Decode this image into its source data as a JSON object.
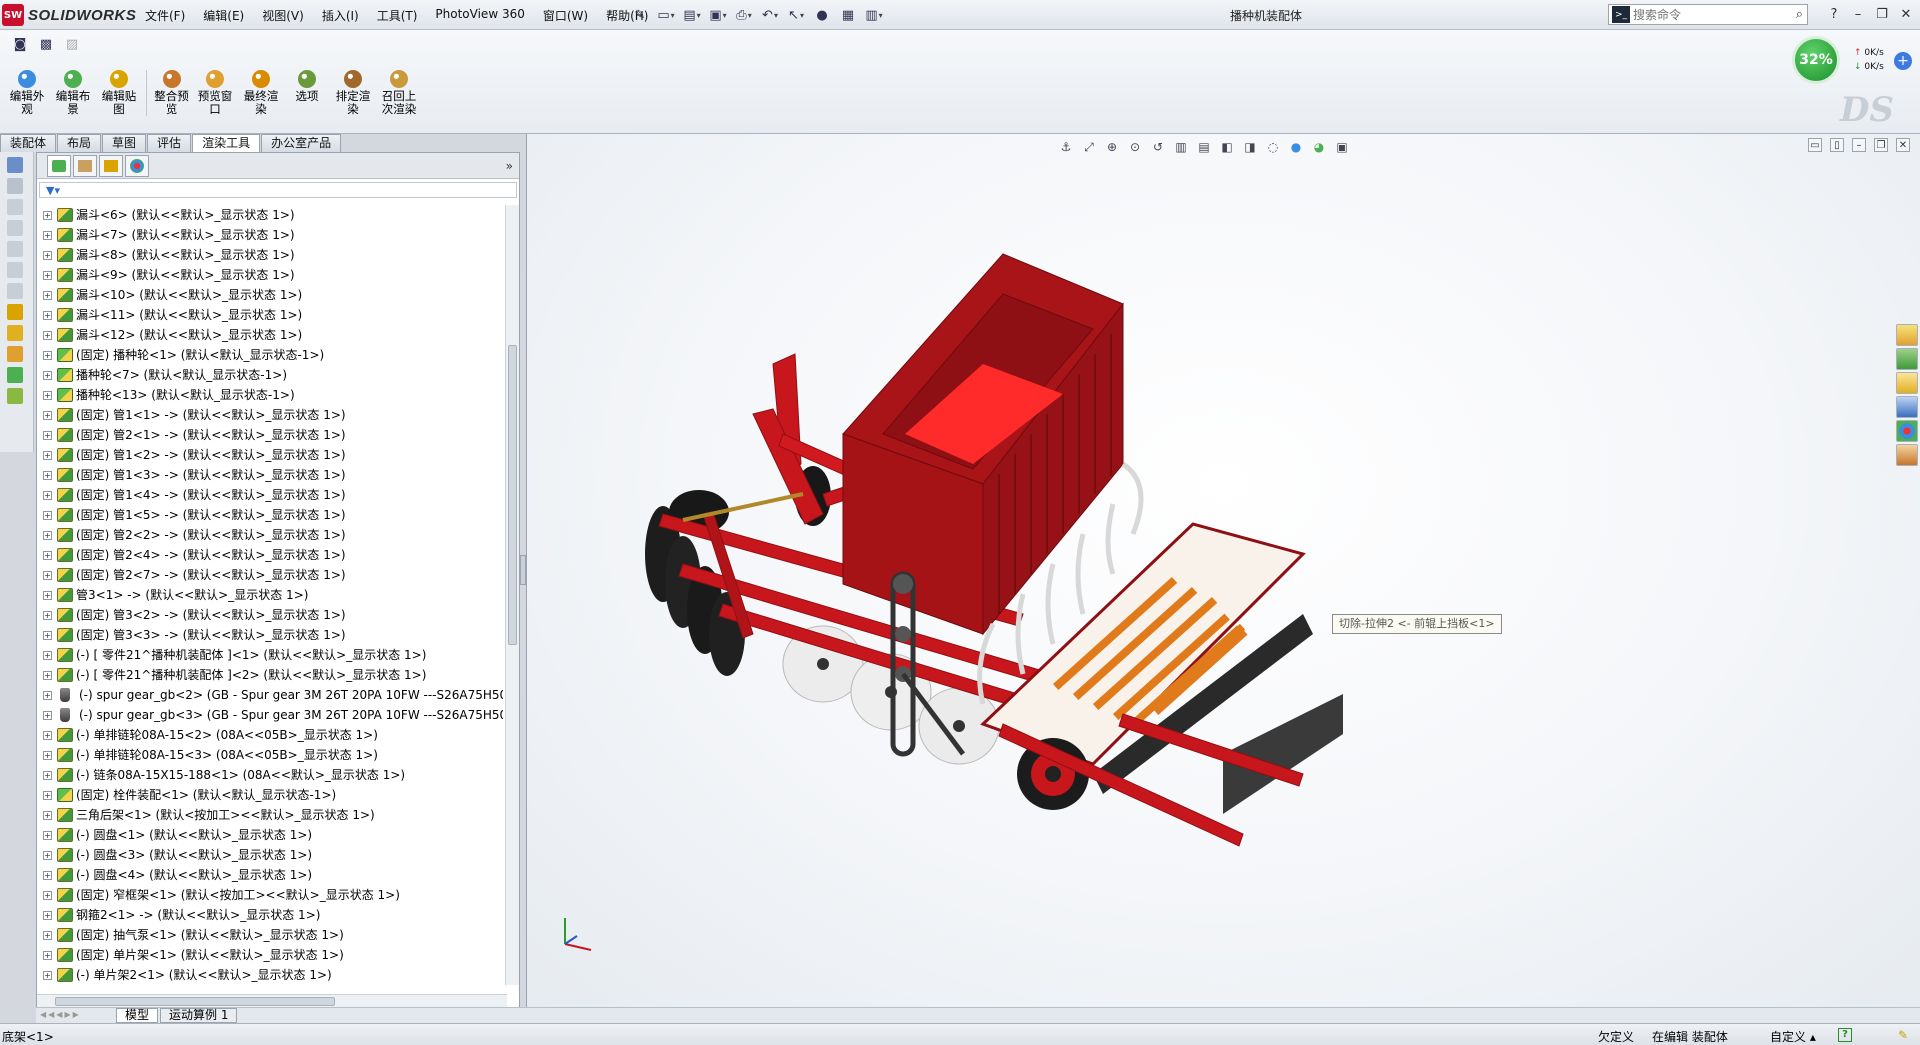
{
  "app": {
    "logo_badge": "SW",
    "logo_text": "SOLIDWORKS",
    "doc_title": "播种机装配体"
  },
  "menu": [
    "文件(F)",
    "编辑(E)",
    "视图(V)",
    "插入(I)",
    "工具(T)",
    "PhotoView 360",
    "窗口(W)",
    "帮助(H)"
  ],
  "search": {
    "placeholder": "搜索命令",
    "cmd_glyph": ">_"
  },
  "ribbon_buttons": [
    {
      "label": "编辑外观",
      "color": "#3a8de0"
    },
    {
      "label": "编辑布景",
      "color": "#4caf50"
    },
    {
      "label": "编辑贴图",
      "color": "#d9a400"
    },
    {
      "label": "整合预览",
      "color": "#c8762a"
    },
    {
      "label": "预览窗口",
      "color": "#e0a030"
    },
    {
      "label": "最终渲染",
      "color": "#d98a00"
    },
    {
      "label": "选项",
      "color": "#6a9a3a"
    },
    {
      "label": "排定渲染",
      "color": "#a0682a"
    },
    {
      "label": "召回上次渲染",
      "color": "#c89a3a"
    }
  ],
  "performance": {
    "percent": "32%",
    "up_rate": "0K/s",
    "down_rate": "0K/s",
    "plus": "+"
  },
  "command_tabs": [
    "装配体",
    "布局",
    "草图",
    "评估",
    "渲染工具",
    "办公室产品"
  ],
  "active_command_tab": "渲染工具",
  "feature_tree": [
    {
      "icon": "asm",
      "label": "漏斗<6> (默认<<默认>_显示状态 1>)"
    },
    {
      "icon": "asm",
      "label": "漏斗<7> (默认<<默认>_显示状态 1>)"
    },
    {
      "icon": "asm",
      "label": "漏斗<8> (默认<<默认>_显示状态 1>)"
    },
    {
      "icon": "asm",
      "label": "漏斗<9> (默认<<默认>_显示状态 1>)"
    },
    {
      "icon": "asm",
      "label": "漏斗<10> (默认<<默认>_显示状态 1>)"
    },
    {
      "icon": "asm",
      "label": "漏斗<11> (默认<<默认>_显示状态 1>)"
    },
    {
      "icon": "asm",
      "label": "漏斗<12> (默认<<默认>_显示状态 1>)"
    },
    {
      "icon": "asm-green",
      "label": "(固定) 播种轮<1> (默认<默认_显示状态-1>)"
    },
    {
      "icon": "asm-green",
      "label": "播种轮<7> (默认<默认_显示状态-1>)"
    },
    {
      "icon": "asm-green",
      "label": "播种轮<13> (默认<默认_显示状态-1>)"
    },
    {
      "icon": "asm",
      "label": "(固定) 管1<1> -> (默认<<默认>_显示状态 1>)"
    },
    {
      "icon": "asm",
      "label": "(固定) 管2<1> -> (默认<<默认>_显示状态 1>)"
    },
    {
      "icon": "asm",
      "label": "(固定) 管1<2> -> (默认<<默认>_显示状态 1>)"
    },
    {
      "icon": "asm",
      "label": "(固定) 管1<3> -> (默认<<默认>_显示状态 1>)"
    },
    {
      "icon": "asm",
      "label": "(固定) 管1<4> -> (默认<<默认>_显示状态 1>)"
    },
    {
      "icon": "asm",
      "label": "(固定) 管1<5> -> (默认<<默认>_显示状态 1>)"
    },
    {
      "icon": "asm",
      "label": "(固定) 管2<2> -> (默认<<默认>_显示状态 1>)"
    },
    {
      "icon": "asm",
      "label": "(固定) 管2<4> -> (默认<<默认>_显示状态 1>)"
    },
    {
      "icon": "asm",
      "label": "(固定) 管2<7> -> (默认<<默认>_显示状态 1>)"
    },
    {
      "icon": "asm",
      "label": "管3<1> -> (默认<<默认>_显示状态 1>)"
    },
    {
      "icon": "asm",
      "label": "(固定) 管3<2> -> (默认<<默认>_显示状态 1>)"
    },
    {
      "icon": "asm",
      "label": "(固定) 管3<3> -> (默认<<默认>_显示状态 1>)"
    },
    {
      "icon": "asm",
      "label": "(-) [ 零件21^播种机装配体 ]<1> (默认<<默认>_显示状态 1>)"
    },
    {
      "icon": "asm",
      "label": "(-) [ 零件21^播种机装配体 ]<2> (默认<<默认>_显示状态 1>)"
    },
    {
      "icon": "part",
      "label": "(-) spur gear_gb<2> (GB - Spur gear 3M 26T 20PA 10FW ---S26A75H50"
    },
    {
      "icon": "part",
      "label": "(-) spur gear_gb<3> (GB - Spur gear 3M 26T 20PA 10FW ---S26A75H50"
    },
    {
      "icon": "asm",
      "label": "(-) 单排链轮08A-15<2> (08A<<05B>_显示状态 1>)"
    },
    {
      "icon": "asm",
      "label": "(-) 单排链轮08A-15<3> (08A<<05B>_显示状态 1>)"
    },
    {
      "icon": "asm",
      "label": "(-) 链条08A-15X15-188<1> (08A<<默认>_显示状态 1>)"
    },
    {
      "icon": "asm-green",
      "label": "(固定) 栓件装配<1> (默认<默认_显示状态-1>)"
    },
    {
      "icon": "asm",
      "label": "三角后架<1> (默认<按加工><<默认>_显示状态 1>)"
    },
    {
      "icon": "asm",
      "label": "(-) 圆盘<1> (默认<<默认>_显示状态 1>)"
    },
    {
      "icon": "asm",
      "label": "(-) 圆盘<3> (默认<<默认>_显示状态 1>)"
    },
    {
      "icon": "asm",
      "label": "(-) 圆盘<4> (默认<<默认>_显示状态 1>)"
    },
    {
      "icon": "asm",
      "label": "(固定) 窄框架<1> (默认<按加工><<默认>_显示状态 1>)"
    },
    {
      "icon": "asm",
      "label": "钢箍2<1> -> (默认<<默认>_显示状态 1>)"
    },
    {
      "icon": "asm",
      "label": "(固定) 抽气泵<1> (默认<<默认>_显示状态 1>)"
    },
    {
      "icon": "asm",
      "label": "(固定) 单片架<1> (默认<<默认>_显示状态 1>)"
    },
    {
      "icon": "asm",
      "label": "(-) 单片架2<1> (默认<<默认>_显示状态 1>)"
    }
  ],
  "viewport": {
    "tooltip": "切除-拉伸2 <- 前辊上挡板<1>"
  },
  "bottom_tabs": [
    "模型",
    "运动算例 1"
  ],
  "active_bottom_tab": "模型",
  "status": {
    "left": "底架<1>",
    "defined": "欠定义",
    "editing": "在编辑 装配体",
    "custom": "自定义",
    "help": "?",
    "pin": "✎"
  },
  "colors": {
    "machine_red": "#c8161d",
    "machine_dark_red": "#8f1014",
    "hopper_inner": "#ff2a2a",
    "seed_orange": "#e07a1a",
    "accent_green": "#2a9a2a"
  }
}
